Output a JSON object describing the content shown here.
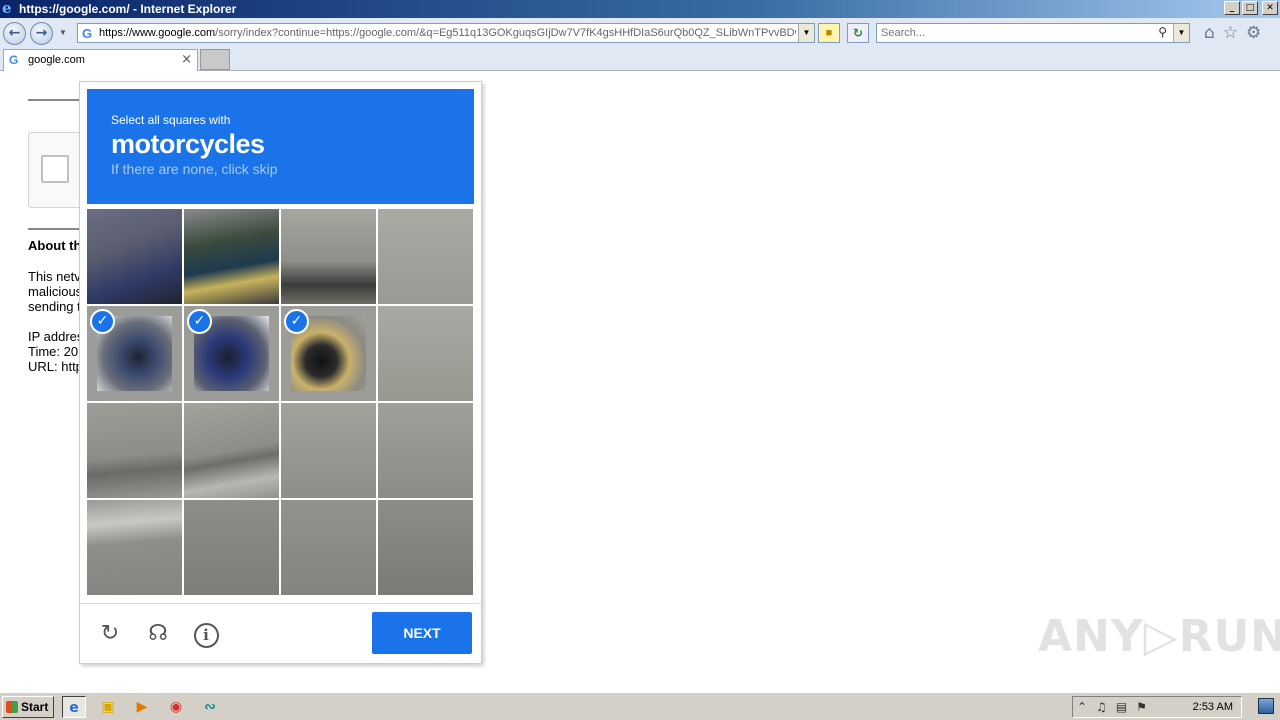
{
  "window": {
    "title": "https://google.com/ - Internet Explorer",
    "min": "_",
    "max": "□",
    "close": "✕"
  },
  "nav": {
    "address_domain": "https://www.google.com",
    "address_path": "/sorry/index?continue=https://google.com/&q=Eg511q13GOKguqsGIjDw7V7fK4gsHHfDIaS6urQb0QZ_SLibWnTPvvBDwE",
    "search_placeholder": "Search..."
  },
  "tabs": [
    {
      "label": "google.com"
    }
  ],
  "page": {
    "about_heading": "About th",
    "para1": [
      "This netv",
      "malicious",
      "sending t"
    ],
    "para2": [
      "IP addres",
      "Time: 20",
      "URL: http"
    ]
  },
  "challenge": {
    "instruction_small": "Select all squares with",
    "target": "motorcycles",
    "hint": "If there are none, click skip",
    "selected_tiles": [
      4,
      5,
      6
    ],
    "tile_count": 16,
    "next_label": "NEXT"
  },
  "watermark": "ANY▷RUN",
  "taskbar": {
    "start_label": "Start",
    "clock": "2:53 AM"
  }
}
